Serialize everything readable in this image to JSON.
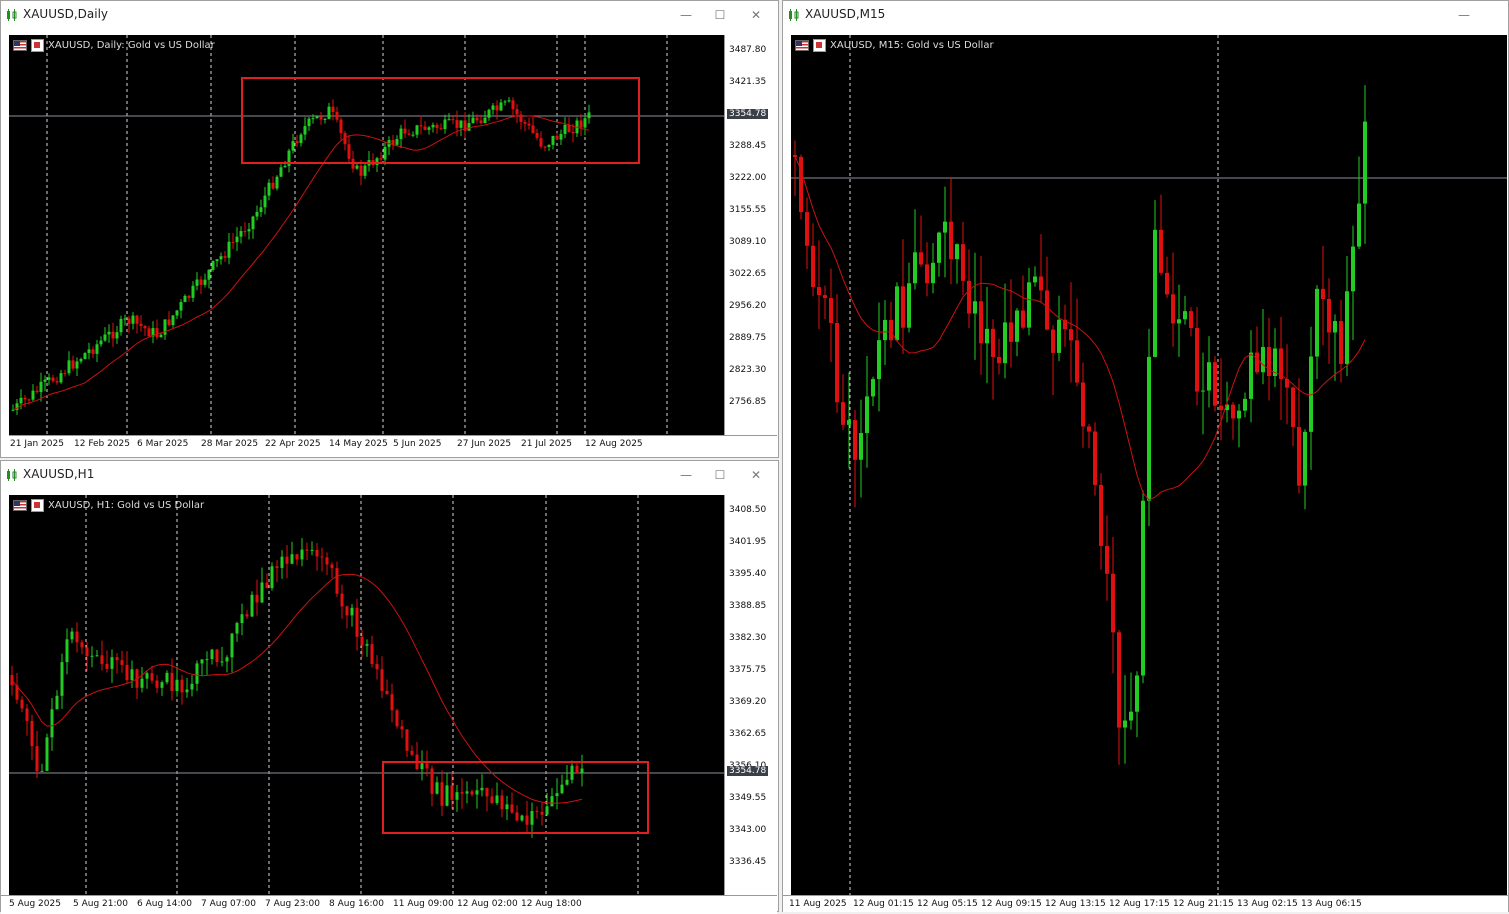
{
  "windows": {
    "daily": {
      "title": "XAUUSD,Daily",
      "info": "XAUUSD, Daily:  Gold vs US Dollar",
      "y_labels": [
        "3487.80",
        "3421.35",
        "3288.45",
        "3222.00",
        "3155.55",
        "3089.10",
        "3022.65",
        "2956.20",
        "2889.75",
        "2823.30",
        "2756.85"
      ],
      "x_labels": [
        "21 Jan 2025",
        "12 Feb 2025",
        "6 Mar 2025",
        "28 Mar 2025",
        "22 Apr 2025",
        "14 May 2025",
        "5 Jun 2025",
        "27 Jun 2025",
        "21 Jul 2025",
        "12 Aug 2025"
      ],
      "current_price": "3354.78"
    },
    "h1": {
      "title": "XAUUSD,H1",
      "info": "XAUUSD, H1:  Gold vs US Dollar",
      "y_labels": [
        "3408.50",
        "3401.95",
        "3395.40",
        "3388.85",
        "3382.30",
        "3375.75",
        "3369.20",
        "3362.65",
        "3356.10",
        "3349.55",
        "3343.00",
        "3336.45"
      ],
      "x_labels": [
        "5 Aug 2025",
        "5 Aug 21:00",
        "6 Aug 14:00",
        "7 Aug 07:00",
        "7 Aug 23:00",
        "8 Aug 16:00",
        "11 Aug 09:00",
        "12 Aug 02:00",
        "12 Aug 18:00"
      ],
      "current_price": "3354.78"
    },
    "m15": {
      "title": "XAUUSD,M15",
      "info": "XAUUSD, M15:  Gold vs US Dollar",
      "x_labels": [
        "11 Aug 2025",
        "12 Aug 01:15",
        "12 Aug 05:15",
        "12 Aug 09:15",
        "12 Aug 13:15",
        "12 Aug 17:15",
        "12 Aug 21:15",
        "13 Aug 02:15",
        "13 Aug 06:15"
      ]
    }
  },
  "controls": {
    "minimize": "—",
    "maximize": "☐",
    "close": "✕"
  },
  "colors": {
    "bull": "#22cc22",
    "bear": "#e01010",
    "ma": "#cc1111",
    "box": "#e02020",
    "grid": "#ffffff"
  }
}
